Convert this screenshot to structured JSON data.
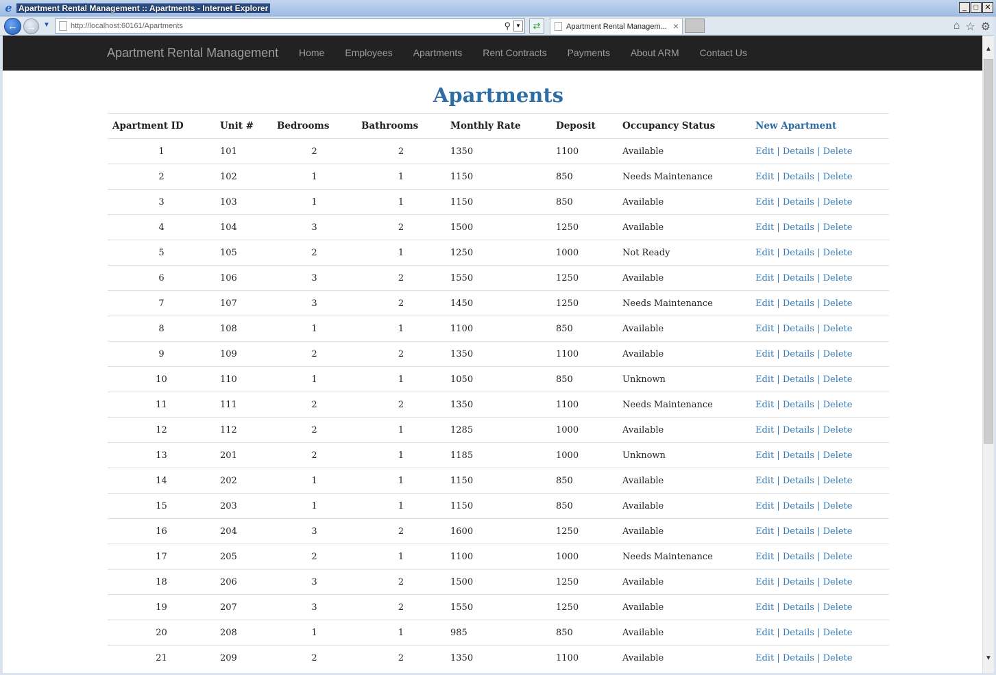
{
  "window": {
    "title": "Apartment Rental Management :: Apartments - Internet Explorer"
  },
  "browser": {
    "url": "http://localhost:60161/Apartments",
    "tab_title": "Apartment Rental Managem..."
  },
  "navbar": {
    "brand": "Apartment Rental Management",
    "links": [
      "Home",
      "Employees",
      "Apartments",
      "Rent Contracts",
      "Payments",
      "About ARM",
      "Contact Us"
    ]
  },
  "page": {
    "title": "Apartments",
    "headers": [
      "Apartment ID",
      "Unit #",
      "Bedrooms",
      "Bathrooms",
      "Monthly Rate",
      "Deposit",
      "Occupancy Status"
    ],
    "new_link": "New Apartment",
    "actions": [
      "Edit",
      "Details",
      "Delete"
    ],
    "rows": [
      [
        "1",
        "101",
        "2",
        "2",
        "1350",
        "1100",
        "Available"
      ],
      [
        "2",
        "102",
        "1",
        "1",
        "1150",
        "850",
        "Needs Maintenance"
      ],
      [
        "3",
        "103",
        "1",
        "1",
        "1150",
        "850",
        "Available"
      ],
      [
        "4",
        "104",
        "3",
        "2",
        "1500",
        "1250",
        "Available"
      ],
      [
        "5",
        "105",
        "2",
        "1",
        "1250",
        "1000",
        "Not Ready"
      ],
      [
        "6",
        "106",
        "3",
        "2",
        "1550",
        "1250",
        "Available"
      ],
      [
        "7",
        "107",
        "3",
        "2",
        "1450",
        "1250",
        "Needs Maintenance"
      ],
      [
        "8",
        "108",
        "1",
        "1",
        "1100",
        "850",
        "Available"
      ],
      [
        "9",
        "109",
        "2",
        "2",
        "1350",
        "1100",
        "Available"
      ],
      [
        "10",
        "110",
        "1",
        "1",
        "1050",
        "850",
        "Unknown"
      ],
      [
        "11",
        "111",
        "2",
        "2",
        "1350",
        "1100",
        "Needs Maintenance"
      ],
      [
        "12",
        "112",
        "2",
        "1",
        "1285",
        "1000",
        "Available"
      ],
      [
        "13",
        "201",
        "2",
        "1",
        "1185",
        "1000",
        "Unknown"
      ],
      [
        "14",
        "202",
        "1",
        "1",
        "1150",
        "850",
        "Available"
      ],
      [
        "15",
        "203",
        "1",
        "1",
        "1150",
        "850",
        "Available"
      ],
      [
        "16",
        "204",
        "3",
        "2",
        "1600",
        "1250",
        "Available"
      ],
      [
        "17",
        "205",
        "2",
        "1",
        "1100",
        "1000",
        "Needs Maintenance"
      ],
      [
        "18",
        "206",
        "3",
        "2",
        "1500",
        "1250",
        "Available"
      ],
      [
        "19",
        "207",
        "3",
        "2",
        "1550",
        "1250",
        "Available"
      ],
      [
        "20",
        "208",
        "1",
        "1",
        "985",
        "850",
        "Available"
      ],
      [
        "21",
        "209",
        "2",
        "2",
        "1350",
        "1100",
        "Available"
      ]
    ]
  },
  "colors": {
    "navbar_bg": "#222222",
    "navbar_text": "#9d9d9d",
    "title_color": "#2e6da4",
    "link_color": "#337ab7"
  }
}
